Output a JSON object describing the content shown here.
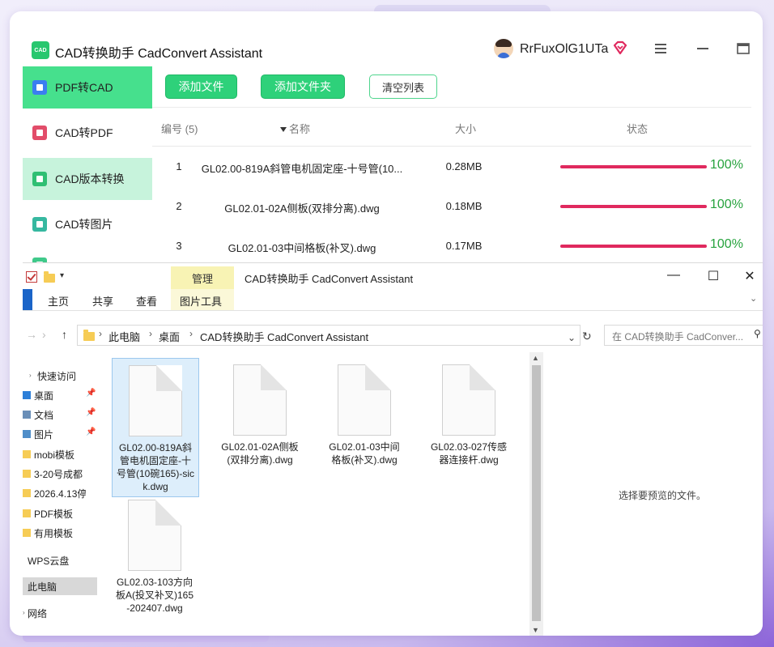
{
  "app": {
    "logo_text": "CAD",
    "title": "CAD转换助手 CadConvert Assistant",
    "username": "RrFuxOlG1UTa"
  },
  "sidebar": {
    "items": [
      {
        "label": "PDF转CAD"
      },
      {
        "label": "CAD转PDF"
      },
      {
        "label": "CAD版本转换"
      },
      {
        "label": "CAD转图片"
      }
    ]
  },
  "toolbar": {
    "add_file": "添加文件",
    "add_folder": "添加文件夹",
    "clear_list": "清空列表"
  },
  "table": {
    "headers": {
      "no": "编号 (5)",
      "name": "名称",
      "size": "大小",
      "status": "状态"
    },
    "rows": [
      {
        "no": "1",
        "name": "GL02.00-819A斜管电机固定座-十号管(10...",
        "size": "0.28MB",
        "progress": 100,
        "pct": "100%"
      },
      {
        "no": "2",
        "name": "GL02.01-02A侧板(双排分离).dwg",
        "size": "0.18MB",
        "progress": 100,
        "pct": "100%"
      },
      {
        "no": "3",
        "name": "GL02.01-03中间格板(补叉).dwg",
        "size": "0.17MB",
        "progress": 100,
        "pct": "100%"
      }
    ]
  },
  "explorer": {
    "manage_tab": "管理",
    "title": "CAD转换助手 CadConvert Assistant",
    "ribbon_tabs": [
      "主页",
      "共享",
      "查看",
      "图片工具"
    ],
    "breadcrumb": [
      "此电脑",
      "桌面",
      "CAD转换助手 CadConvert Assistant"
    ],
    "search_placeholder": "在 CAD转换助手 CadConver...",
    "nav_pane": {
      "quick_access": "快速访问",
      "pinned": [
        "桌面",
        "文档",
        "图片"
      ],
      "folders": [
        "mobi模板",
        "3-20号成都",
        "2026.4.13停",
        "PDF模板",
        "有用模板"
      ],
      "wps": "WPS云盘",
      "this_pc": "此电脑",
      "network": "网络"
    },
    "files": [
      {
        "name": "GL02.00-819A斜管电机固定座-十号管(10碗165)-sick.dwg"
      },
      {
        "name": "GL02.01-02A侧板(双排分离).dwg"
      },
      {
        "name": "GL02.01-03中间格板(补叉).dwg"
      },
      {
        "name": "GL02.03-027传感器连接杆.dwg"
      },
      {
        "name": "GL02.03-103方向板A(投叉补叉)165-202407.dwg"
      }
    ],
    "preview_empty": "选择要预览的文件。"
  },
  "colors": {
    "accent_green": "#2ed17a",
    "progress_bar": "#e0295e",
    "progress_text": "#27a33e"
  }
}
